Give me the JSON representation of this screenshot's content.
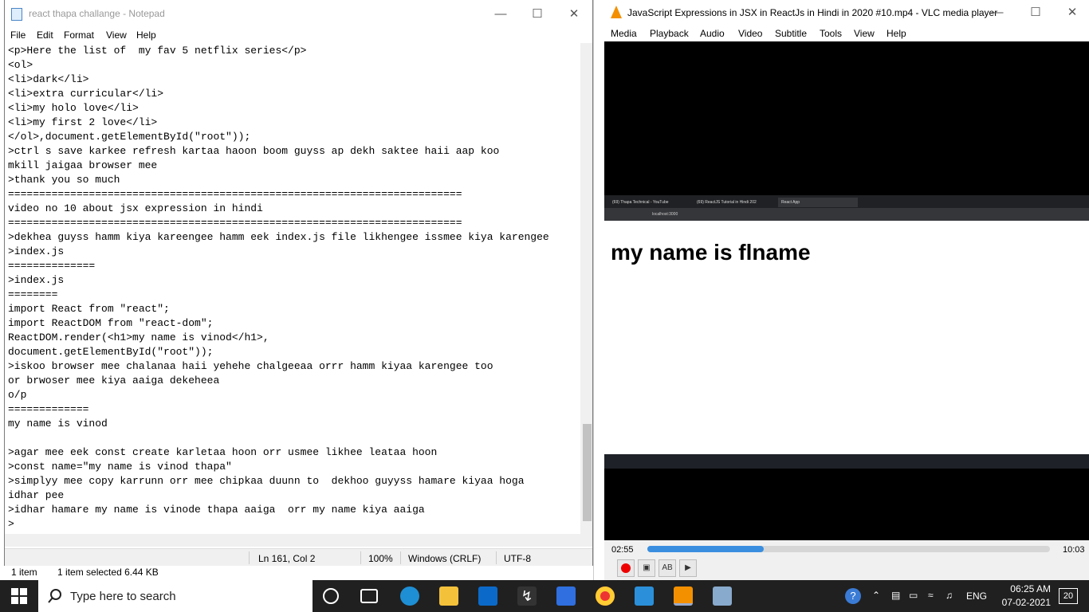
{
  "notepad": {
    "title": "react thapa challange - Notepad",
    "menu": [
      "File",
      "Edit",
      "Format",
      "View",
      "Help"
    ],
    "lines": [
      "<p>Here the list of  my fav 5 netflix series</p>",
      "<ol>",
      "<li>dark</li>",
      "<li>extra curricular</li>",
      "<li>my holo love</li>",
      "<li>my first 2 love</li>",
      "</ol>,document.getElementById(\"root\"));",
      ">ctrl s save karkee refresh kartaa haoon boom guyss ap dekh saktee haii aap koo",
      "mkill jaigaa browser mee",
      ">thank you so much",
      "=========================================================================",
      "video no 10 about jsx expression in hindi",
      "=========================================================================",
      ">dekhea guyss hamm kiya kareengee hamm eek index.js file likhengee issmee kiya karengee",
      ">index.js",
      "==============",
      ">index.js",
      "========",
      "import React from \"react\";",
      "import ReactDOM from \"react-dom\";",
      "ReactDOM.render(<h1>my name is vinod</h1>,",
      "document.getElementById(\"root\"));",
      ">iskoo browser mee chalanaa haii yehehe chalgeeaa orrr hamm kiyaa karengee too",
      "or brwoser mee kiya aaiga dekeheea",
      "o/p",
      "=============",
      "my name is vinod",
      "",
      ">agar mee eek const create karletaa hoon orr usmee likhee leataa hoon",
      ">const name=\"my name is vinod thapa\"",
      ">simplyy mee copy karrunn orr mee chipkaa duunn to  dekhoo guyyss hamare kiyaa hoga",
      "idhar pee",
      ">idhar hamare my name is vinode thapa aaiga  orr my name kiya aaiga",
      ">"
    ],
    "status": {
      "position": "Ln 161, Col 2",
      "zoom": "100%",
      "eol": "Windows (CRLF)",
      "encoding": "UTF-8"
    }
  },
  "explorer_status": {
    "items": "1 item",
    "selected": "1 item selected  6.44 KB"
  },
  "vlc": {
    "title": "JavaScript Expressions in JSX in ReactJs in Hindi in 2020 #10.mp4 - VLC media player",
    "menu": [
      "Media",
      "Playback",
      "Audio",
      "Video",
      "Subtitle",
      "Tools",
      "View",
      "Help"
    ],
    "time_elapsed": "02:55",
    "time_total": "10:03",
    "progress_fraction": 0.29,
    "browser": {
      "tabs": [
        "(69) Thapa Technical - YouTube",
        "(69) ReactJS Tutorial in Hindi 202",
        "React App"
      ],
      "address": "localhost:3000",
      "heading": "my name is flname"
    }
  },
  "taskbar": {
    "search_placeholder": "Type here to search",
    "language": "ENG",
    "time": "06:25 AM",
    "date": "07-02-2021",
    "notifications": "20"
  }
}
